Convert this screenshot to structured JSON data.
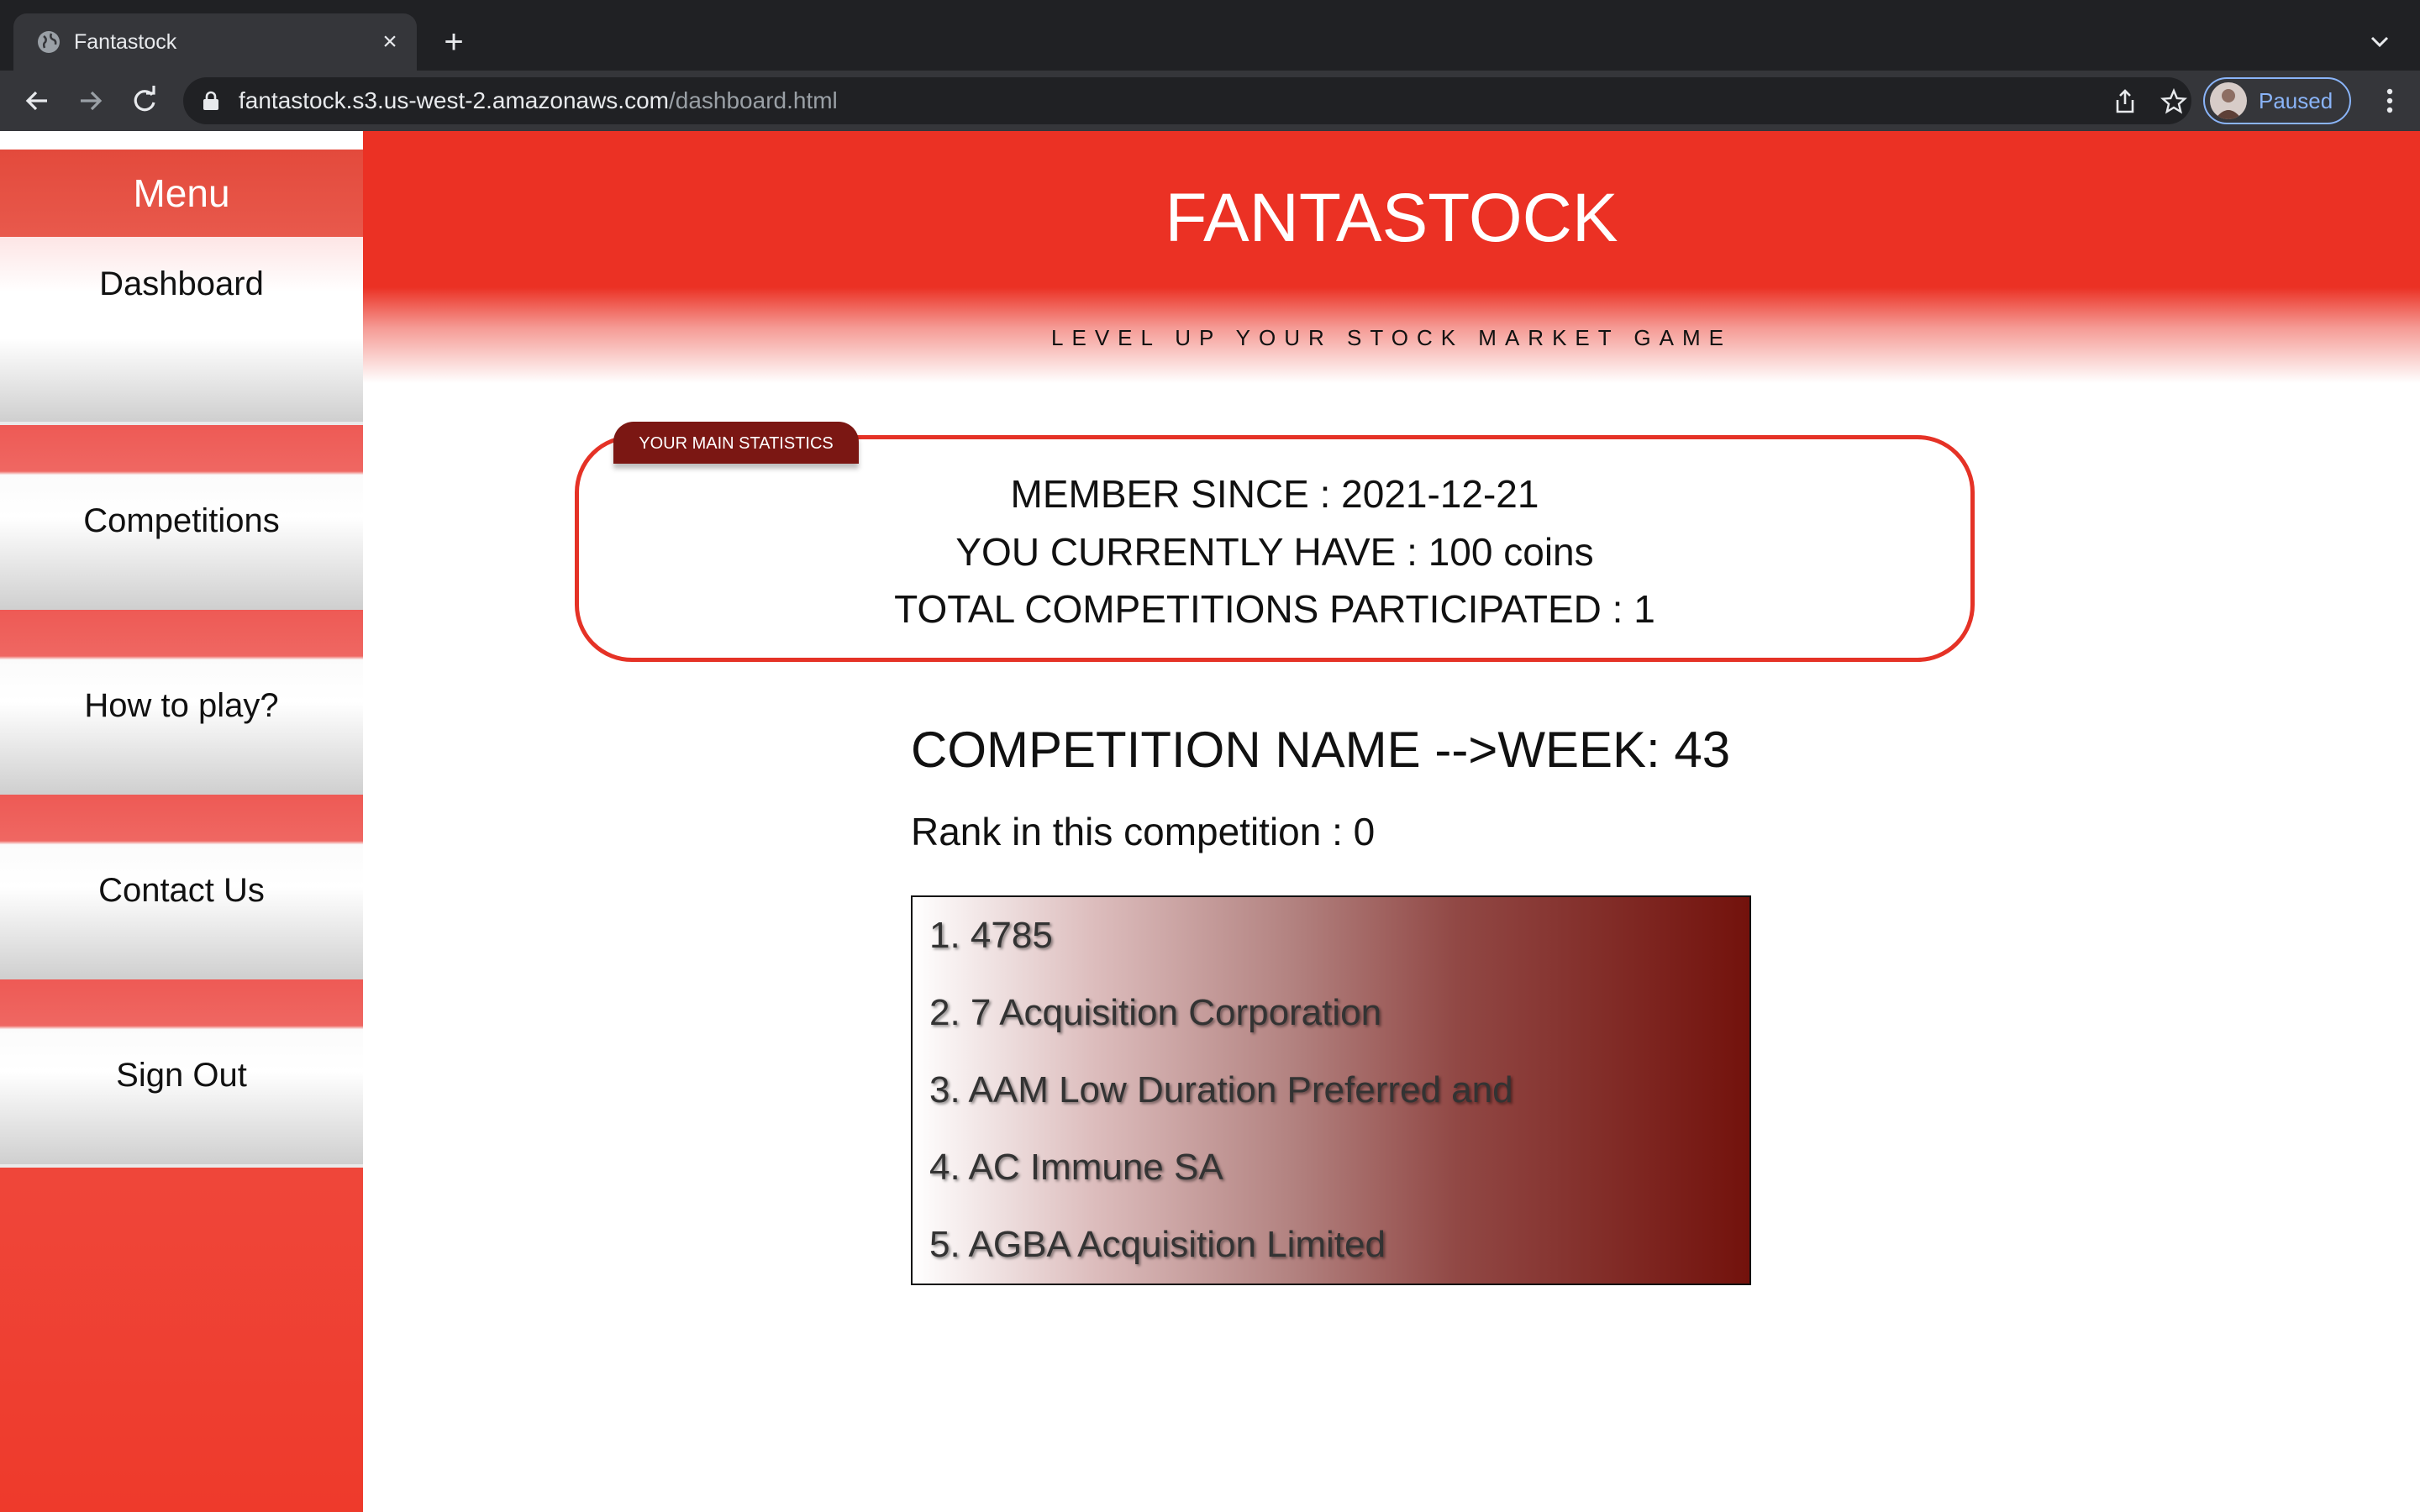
{
  "browser": {
    "tab_title": "Fantastock",
    "tab_close": "×",
    "new_tab": "+",
    "url_host": "fantastock.s3.us-west-2.amazonaws.com",
    "url_path": "/dashboard.html",
    "profile_status": "Paused"
  },
  "sidebar": {
    "header": "Menu",
    "items": [
      {
        "label": "Dashboard"
      },
      {
        "label": "Competitions"
      },
      {
        "label": "How to play?"
      },
      {
        "label": "Contact Us"
      },
      {
        "label": "Sign Out"
      }
    ]
  },
  "header": {
    "title": "FANTASTOCK",
    "tagline": "LEVEL UP YOUR STOCK MARKET GAME"
  },
  "stats": {
    "tag": "YOUR MAIN STATISTICS",
    "member_since": "MEMBER SINCE : 2021-12-21",
    "coins": "YOU CURRENTLY HAVE : 100 coins",
    "competitions": "TOTAL COMPETITIONS PARTICIPATED : 1"
  },
  "competition": {
    "name": "COMPETITION NAME -->WEEK: 43",
    "rank": "Rank in this competition : 0",
    "stocks": [
      "1. 4785",
      "2. 7 Acquisition Corporation",
      "3. AAM Low Duration Preferred and",
      "4. AC Immune SA",
      "5. AGBA Acquisition Limited"
    ]
  },
  "colors": {
    "brand_red": "#eb3124",
    "tag_dark_red": "#7b1713"
  }
}
